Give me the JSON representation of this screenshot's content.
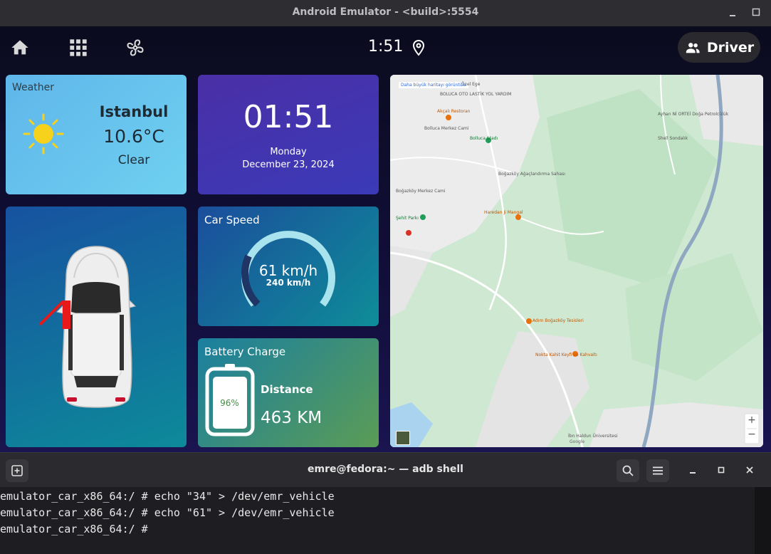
{
  "window": {
    "title": "Android Emulator - <build>:5554"
  },
  "topbar": {
    "time": "1:51",
    "driver_label": "Driver",
    "icons": [
      "home-icon",
      "apps-grid-icon",
      "fan-icon",
      "location-pin-icon",
      "people-icon"
    ]
  },
  "weather": {
    "label": "Weather",
    "city": "Istanbul",
    "temperature": "10.6°C",
    "condition": "Clear",
    "icon": "sun-icon"
  },
  "clock": {
    "time": "01:51",
    "day": "Monday",
    "date": "December 23, 2024"
  },
  "speed": {
    "label": "Car Speed",
    "value": "61 km/h",
    "max": "240 km/h",
    "fraction": 0.254
  },
  "battery": {
    "label": "Battery Charge",
    "percent": "96%",
    "level": 0.96,
    "distance_label": "Distance",
    "distance": "463 KM"
  },
  "map": {
    "banner": "Daha büyük haritayı görüntüle",
    "labels": [
      "Özel Ege",
      "BOLUCA OTO LASTİK YOL YARDIM",
      "Akçalı Restoran",
      "Bollucа Merkez Cami",
      "Bolluca Stadı",
      "Boğazköy Ağaçlandırma Sahası",
      "Boğazköy Merkez Cami",
      "Haredan Ji Mangal",
      "Şehit Parkı",
      "Adım Boğazköy Tesisleri",
      "Nokta Kahit Keyfi ve Kahvaltı",
      "Ayhan Nİ ORTEİ Doğa Petrolcülük",
      "Shell Sondalık",
      "İbn Haldun Üniversitesi",
      "Google"
    ],
    "zoom_in": "+",
    "zoom_out": "−"
  },
  "terminal": {
    "title": "emre@fedora:~ — adb shell",
    "lines": [
      "emulator_car_x86_64:/ # echo \"34\" > /dev/emr_vehicle",
      "emulator_car_x86_64:/ # echo \"61\" > /dev/emr_vehicle",
      "emulator_car_x86_64:/ # "
    ]
  },
  "colors": {
    "weather_bg": "#5fb6ea",
    "clock_bg": "#4a2fa6",
    "speed_arc": "#a8e3ee",
    "battery_fill": "#ffffff",
    "door_arrow": "#e8191a"
  }
}
